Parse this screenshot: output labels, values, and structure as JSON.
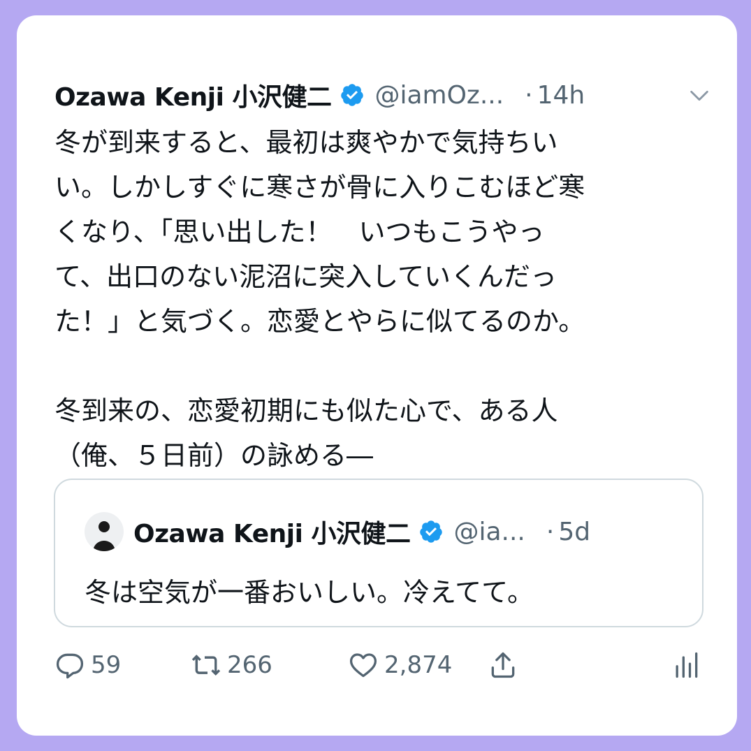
{
  "tweet": {
    "display_name": "Ozawa Kenji 小沢健二",
    "handle": "@iamOz...",
    "separator": "·",
    "time": "14h",
    "text": "冬が到来すると、最初は爽やかで気持ちい\nい。しかしすぐに寒さが骨に入りこむほど寒\nくなり、「思い出した！　いつもこうやっ\nて、出口のない泥沼に突入していくんだっ\nた！」と気づく。恋愛とやらに似てるのか。\n\n冬到来の、恋愛初期にも似た心で、ある人\n（俺、５日前）の詠める―"
  },
  "quoted": {
    "display_name": "Ozawa Kenji 小沢健二",
    "handle": "@ia...",
    "separator": "·",
    "time": "5d",
    "text": "冬は空気が一番おいしい。冷えてて。"
  },
  "actions": {
    "replies": "59",
    "retweets": "266",
    "likes": "2,874"
  },
  "icons": {
    "verified": "verified-badge-icon",
    "menu": "chevron-down-icon",
    "reply": "reply-icon",
    "retweet": "retweet-icon",
    "like": "heart-icon",
    "share": "share-icon",
    "analytics": "analytics-icon"
  },
  "colors": {
    "background": "#b5a8f2",
    "verified": "#1d9bf0",
    "muted": "#536471"
  }
}
